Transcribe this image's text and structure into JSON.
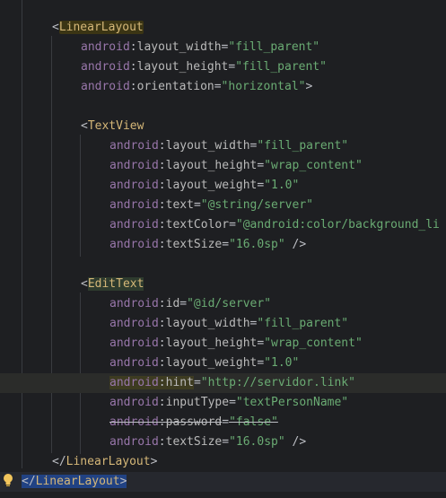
{
  "editor": {
    "lines": [
      {
        "indent": 2,
        "kind": "open",
        "tag": "LinearLayout"
      },
      {
        "indent": 3,
        "ns": "android",
        "attr": "layout_width",
        "value": "\"fill_parent\""
      },
      {
        "indent": 3,
        "ns": "android",
        "attr": "layout_height",
        "value": "\"fill_parent\""
      },
      {
        "indent": 3,
        "ns": "android",
        "attr": "orientation",
        "value": "\"horizontal\"",
        "suffix": ">"
      },
      {
        "indent": 0,
        "kind": "blank"
      },
      {
        "indent": 3,
        "kind": "open",
        "tag": "TextView"
      },
      {
        "indent": 4,
        "ns": "android",
        "attr": "layout_width",
        "value": "\"fill_parent\""
      },
      {
        "indent": 4,
        "ns": "android",
        "attr": "layout_height",
        "value": "\"wrap_content\""
      },
      {
        "indent": 4,
        "ns": "android",
        "attr": "layout_weight",
        "value": "\"1.0\""
      },
      {
        "indent": 4,
        "ns": "android",
        "attr": "text",
        "value": "\"@string/server\""
      },
      {
        "indent": 4,
        "ns": "android",
        "attr": "textColor",
        "value": "\"@android:color/background_li"
      },
      {
        "indent": 4,
        "ns": "android",
        "attr": "textSize",
        "value": "\"16.0sp\"",
        "suffix": " />"
      },
      {
        "indent": 0,
        "kind": "blank"
      },
      {
        "indent": 3,
        "kind": "open",
        "tag": "EditText"
      },
      {
        "indent": 4,
        "ns": "android",
        "attr": "id",
        "value": "\"@id/server\""
      },
      {
        "indent": 4,
        "ns": "android",
        "attr": "layout_width",
        "value": "\"fill_parent\""
      },
      {
        "indent": 4,
        "ns": "android",
        "attr": "layout_height",
        "value": "\"wrap_content\""
      },
      {
        "indent": 4,
        "ns": "android",
        "attr": "layout_weight",
        "value": "\"1.0\""
      },
      {
        "indent": 4,
        "ns": "android",
        "attr": "hint",
        "value": "\"http://servidor.link\""
      },
      {
        "indent": 4,
        "ns": "android",
        "attr": "inputType",
        "value": "\"textPersonName\""
      },
      {
        "indent": 4,
        "ns": "android",
        "attr": "password",
        "value": "\"false\"",
        "strike": true
      },
      {
        "indent": 4,
        "ns": "android",
        "attr": "textSize",
        "value": "\"16.0sp\"",
        "suffix": " />"
      },
      {
        "indent": 2,
        "kind": "close",
        "tag": "LinearLayout"
      },
      {
        "indent": 1,
        "kind": "close",
        "tag": "LinearLayout",
        "current": true
      }
    ]
  },
  "icons": {
    "intention": "lightbulb-icon"
  },
  "colors": {
    "background": "#1e1f22",
    "tag": "#d5b778",
    "namespace": "#9876aa",
    "attribute": "#bababa",
    "value": "#6aab73"
  }
}
